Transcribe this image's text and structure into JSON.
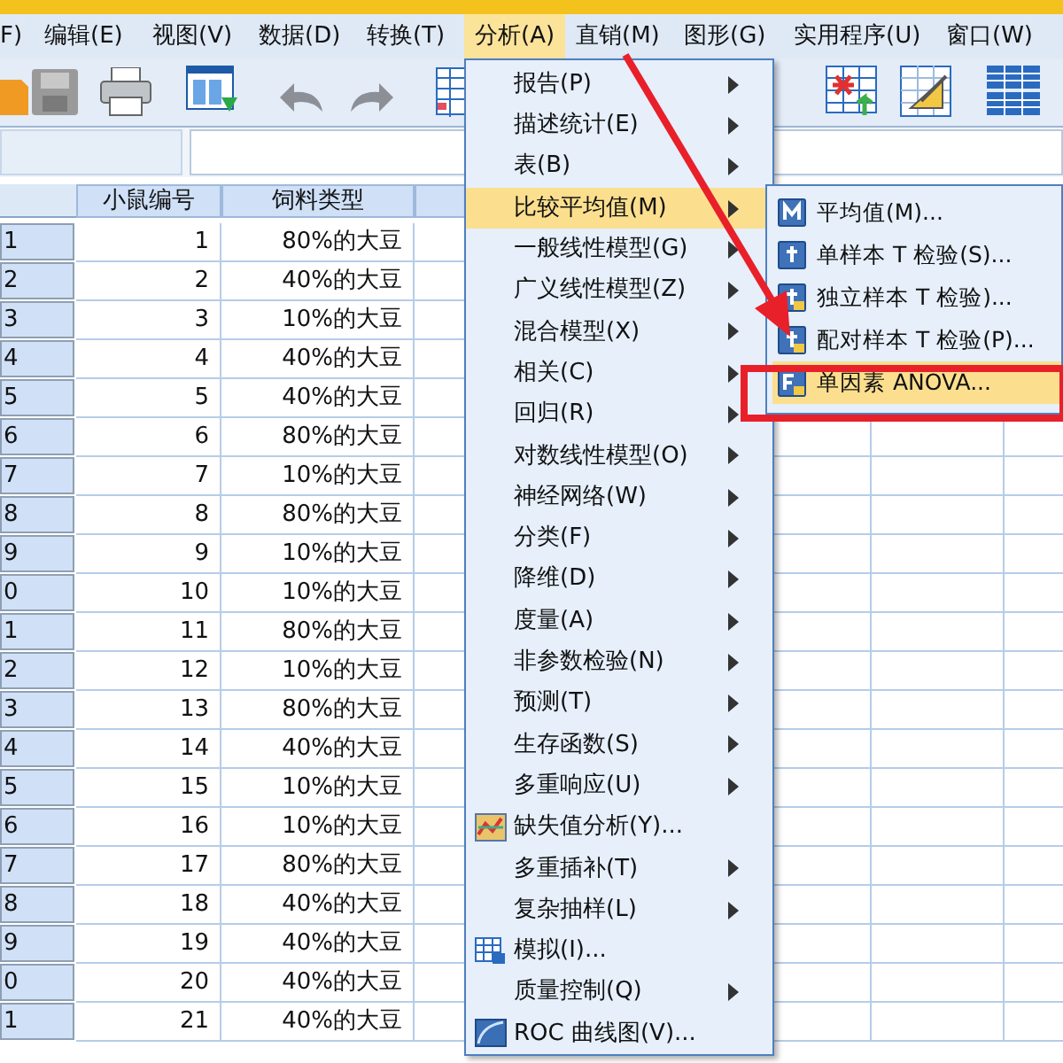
{
  "menubar": [
    {
      "label": "F)",
      "selected": false
    },
    {
      "label": "编辑(E)",
      "selected": false
    },
    {
      "label": "视图(V)",
      "selected": false
    },
    {
      "label": "数据(D)",
      "selected": false
    },
    {
      "label": "转换(T)",
      "selected": false
    },
    {
      "label": "分析(A)",
      "selected": true
    },
    {
      "label": "直销(M)",
      "selected": false
    },
    {
      "label": "图形(G)",
      "selected": false
    },
    {
      "label": "实用程序(U)",
      "selected": false
    },
    {
      "label": "窗口(W)",
      "selected": false
    }
  ],
  "table": {
    "columns": [
      "小鼠编号",
      "饲料类型"
    ],
    "rows": [
      {
        "row_number": "1",
        "id": "1",
        "feed": "80%的大豆"
      },
      {
        "row_number": "2",
        "id": "2",
        "feed": "40%的大豆"
      },
      {
        "row_number": "3",
        "id": "3",
        "feed": "10%的大豆"
      },
      {
        "row_number": "4",
        "id": "4",
        "feed": "40%的大豆"
      },
      {
        "row_number": "5",
        "id": "5",
        "feed": "40%的大豆"
      },
      {
        "row_number": "6",
        "id": "6",
        "feed": "80%的大豆"
      },
      {
        "row_number": "7",
        "id": "7",
        "feed": "10%的大豆"
      },
      {
        "row_number": "8",
        "id": "8",
        "feed": "80%的大豆"
      },
      {
        "row_number": "9",
        "id": "9",
        "feed": "10%的大豆"
      },
      {
        "row_number": "0",
        "id": "10",
        "feed": "10%的大豆"
      },
      {
        "row_number": "1",
        "id": "11",
        "feed": "80%的大豆"
      },
      {
        "row_number": "2",
        "id": "12",
        "feed": "10%的大豆"
      },
      {
        "row_number": "3",
        "id": "13",
        "feed": "80%的大豆"
      },
      {
        "row_number": "4",
        "id": "14",
        "feed": "40%的大豆"
      },
      {
        "row_number": "5",
        "id": "15",
        "feed": "10%的大豆"
      },
      {
        "row_number": "6",
        "id": "16",
        "feed": "10%的大豆"
      },
      {
        "row_number": "7",
        "id": "17",
        "feed": "80%的大豆"
      },
      {
        "row_number": "8",
        "id": "18",
        "feed": "40%的大豆"
      },
      {
        "row_number": "9",
        "id": "19",
        "feed": "40%的大豆"
      },
      {
        "row_number": "0",
        "id": "20",
        "feed": "40%的大豆"
      },
      {
        "row_number": "1",
        "id": "21",
        "feed": "40%的大豆"
      }
    ]
  },
  "analyze_menu": [
    {
      "label": "报告(P)",
      "kind": "submenu",
      "selected": false
    },
    {
      "label": "描述统计(E)",
      "kind": "submenu",
      "selected": false
    },
    {
      "label": "表(B)",
      "kind": "submenu",
      "selected": false
    },
    {
      "label": "比较平均值(M)",
      "kind": "submenu",
      "selected": true
    },
    {
      "label": "一般线性模型(G)",
      "kind": "submenu",
      "selected": false
    },
    {
      "label": "广义线性模型(Z)",
      "kind": "submenu",
      "selected": false
    },
    {
      "label": "混合模型(X)",
      "kind": "submenu",
      "selected": false
    },
    {
      "label": "相关(C)",
      "kind": "submenu",
      "selected": false
    },
    {
      "label": "回归(R)",
      "kind": "submenu",
      "selected": false
    },
    {
      "label": "对数线性模型(O)",
      "kind": "submenu",
      "selected": false
    },
    {
      "label": "神经网络(W)",
      "kind": "submenu",
      "selected": false
    },
    {
      "label": "分类(F)",
      "kind": "submenu",
      "selected": false
    },
    {
      "label": "降维(D)",
      "kind": "submenu",
      "selected": false
    },
    {
      "label": "度量(A)",
      "kind": "submenu",
      "selected": false
    },
    {
      "label": "非参数检验(N)",
      "kind": "submenu",
      "selected": false
    },
    {
      "label": "预测(T)",
      "kind": "submenu",
      "selected": false
    },
    {
      "label": "生存函数(S)",
      "kind": "submenu",
      "selected": false
    },
    {
      "label": "多重响应(U)",
      "kind": "submenu",
      "selected": false
    },
    {
      "label": "缺失值分析(Y)...",
      "kind": "action",
      "selected": false
    },
    {
      "label": "多重插补(T)",
      "kind": "submenu",
      "selected": false
    },
    {
      "label": "复杂抽样(L)",
      "kind": "submenu",
      "selected": false
    },
    {
      "label": "模拟(I)...",
      "kind": "action",
      "selected": false
    },
    {
      "label": "质量控制(Q)",
      "kind": "submenu",
      "selected": false
    },
    {
      "label": "ROC 曲线图(V)...",
      "kind": "action",
      "selected": false
    }
  ],
  "compare_means_submenu": [
    {
      "label": "平均值(M)...",
      "selected": false
    },
    {
      "label": "单样本 T 检验(S)...",
      "selected": false
    },
    {
      "label": "独立样本 T 检验)...",
      "selected": false
    },
    {
      "label": "配对样本 T 检验(P)...",
      "selected": false
    },
    {
      "label": "单因素 ANOVA...",
      "selected": true
    }
  ]
}
